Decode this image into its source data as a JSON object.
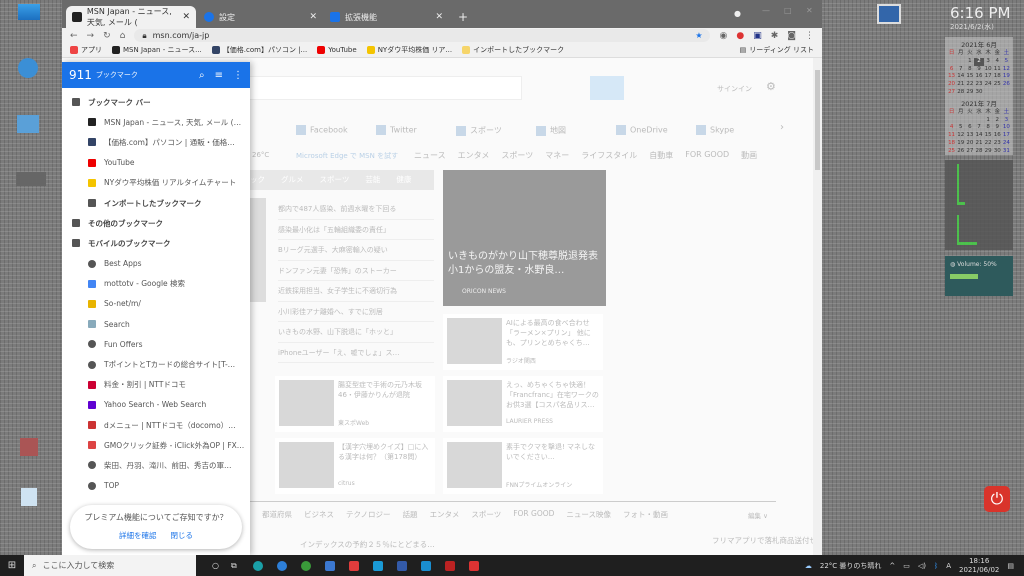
{
  "browser": {
    "tabs": [
      {
        "title": "MSN Japan - ニュース, 天気, メール (",
        "active": true
      },
      {
        "title": "設定"
      },
      {
        "title": "拡張機能"
      }
    ],
    "new_tab": "+",
    "url": "msn.com/ja-jp",
    "bookmarks_bar": [
      {
        "label": "アプリ",
        "color": "#e44"
      },
      {
        "label": "MSN Japan - ニュース...",
        "color": "#222"
      },
      {
        "label": "【価格.com】パソコン |...",
        "color": "#346"
      },
      {
        "label": "YouTube",
        "color": "#e00"
      },
      {
        "label": "NYダウ平均株価 リア...",
        "color": "#f4c400"
      },
      {
        "label": "インポートしたブックマーク",
        "color": "#f6d56a"
      }
    ],
    "reading_list": "リーディング リスト"
  },
  "panel": {
    "count": "911",
    "title": "ブックマーク",
    "items": [
      {
        "label": "ブックマーク バー",
        "type": "folder",
        "indent": 0
      },
      {
        "label": "MSN Japan - ニュース, 天気, メール (…",
        "type": "link",
        "indent": 1,
        "color": "#222"
      },
      {
        "label": "【価格.com】パソコン | 通販・価格…",
        "type": "link",
        "indent": 1,
        "color": "#346"
      },
      {
        "label": "YouTube",
        "type": "link",
        "indent": 1,
        "color": "#e00"
      },
      {
        "label": "NYダウ平均株価 リアルタイムチャート",
        "type": "link",
        "indent": 1,
        "color": "#f4c400"
      },
      {
        "label": "インポートしたブックマーク",
        "type": "folder",
        "indent": 1
      },
      {
        "label": "その他のブックマーク",
        "type": "folder",
        "indent": 0
      },
      {
        "label": "モバイルのブックマーク",
        "type": "folder",
        "indent": 0
      },
      {
        "label": "Best Apps",
        "type": "globe",
        "indent": 1
      },
      {
        "label": "mottotv - Google 検索",
        "type": "link",
        "indent": 1,
        "color": "#4285f4"
      },
      {
        "label": "So-net/m/",
        "type": "link",
        "indent": 1,
        "color": "#e8b400"
      },
      {
        "label": "Search",
        "type": "link",
        "indent": 1,
        "color": "#8ab"
      },
      {
        "label": "Fun Offers",
        "type": "globe",
        "indent": 1
      },
      {
        "label": "TポイントとTカードの総合サイト[T-…",
        "type": "globe",
        "indent": 1
      },
      {
        "label": "料金・割引 | NTTドコモ",
        "type": "link",
        "indent": 1,
        "color": "#c03"
      },
      {
        "label": "Yahoo Search - Web Search",
        "type": "link",
        "indent": 1,
        "color": "#5f01d1"
      },
      {
        "label": "dメニュー | NTTドコモ（docomo）…",
        "type": "link",
        "indent": 1,
        "color": "#c33"
      },
      {
        "label": "GMOクリック証券 - iClick外為OP | FX…",
        "type": "link",
        "indent": 1,
        "color": "#d44"
      },
      {
        "label": "柴田、丹羽、滝川、前田、秀吉の軍…",
        "type": "globe",
        "indent": 1
      },
      {
        "label": "TOP",
        "type": "globe",
        "indent": 1
      }
    ],
    "promo": {
      "text": "プレミアム機能についてご存知ですか？",
      "learn": "詳細を確認",
      "close": "閉じる"
    }
  },
  "msn": {
    "signin": "サインイン",
    "quicklinks": [
      "Facebook",
      "Twitter",
      "スポーツ",
      "地図",
      "OneDrive",
      "Skype"
    ],
    "temp": "26°C",
    "edge_promo": "Microsoft Edge で MSN を試す",
    "nav": [
      "ニュース",
      "エンタメ",
      "スポーツ",
      "マネー",
      "ライフスタイル",
      "自動車",
      "FOR GOOD",
      "動画"
    ],
    "subnav": [
      "ック",
      "グルメ",
      "スポーツ",
      "芸能",
      "健康"
    ],
    "headlines": [
      "都内で487人感染、前週水曜を下回る",
      "感染最小化は「五輪組織委の責任」",
      "Bリーグ元選手、大麻密輸入の疑い",
      "ドンファン元妻「恐怖」のストーカー",
      "近鉄採用担当、女子学生に不適切行為",
      "小川彩佳アナ離婚へ、すでに別居",
      "いきもの水野、山下脱退に「ホッと」",
      "iPhoneユーザー「え、嘘でしょ」ス…"
    ],
    "hero": {
      "title": "いきものがかり山下穂尊脱退発表 小1からの盟友・水野良…",
      "source": "ORICON NEWS"
    },
    "cards": [
      {
        "title": "AIによる最高の食べ合わせ「ラーメン×プリン」 他にも、プリンとめちゃくち…",
        "source": "ラジオ関西"
      },
      {
        "title": "腸変型症で手術の元乃木坂46・伊藤かりんが退院",
        "source": "東スポWeb"
      },
      {
        "title": "えっ、めちゃくちゃ快適！「Francfranc」在宅ワークのお供3選【コスパ名品リス…",
        "source": "LAURIER PRESS"
      },
      {
        "title": "【漢字穴埋めクイズ】□に入る漢字は何？（第178問）",
        "source": "citrus"
      },
      {
        "title": "素手でクマを撃退! マネしないでください…",
        "source": "FNNプライムオンライン"
      }
    ],
    "nav2": [
      "都道府県",
      "ビジネス",
      "テクノロジー",
      "話題",
      "エンタメ",
      "スポーツ",
      "FOR GOOD",
      "ニュース映像",
      "フォト・動画"
    ],
    "edit": "編集 ∨",
    "bottom_left": "インデックスの予約２５％にとどまる…",
    "bottom_right": "フリマアプリで落札商品送付せず 詐欺容疑で３１歳男を"
  },
  "widgets": {
    "time": "6:16 PM",
    "date": "2021/6/2(水)",
    "weekdays": [
      "日",
      "月",
      "火",
      "水",
      "木",
      "金",
      "土"
    ],
    "months": [
      {
        "label": "2021年 6月",
        "first": 2,
        "days": 30,
        "today": 2
      },
      {
        "label": "2021年 7月",
        "first": 4,
        "days": 31
      }
    ],
    "volume": "Volume: 50%"
  },
  "taskbar": {
    "search_placeholder": "ここに入力して検索",
    "weather": "22°C 曇りのち晴れ",
    "time": "18:16",
    "date": "2021/06/02"
  }
}
